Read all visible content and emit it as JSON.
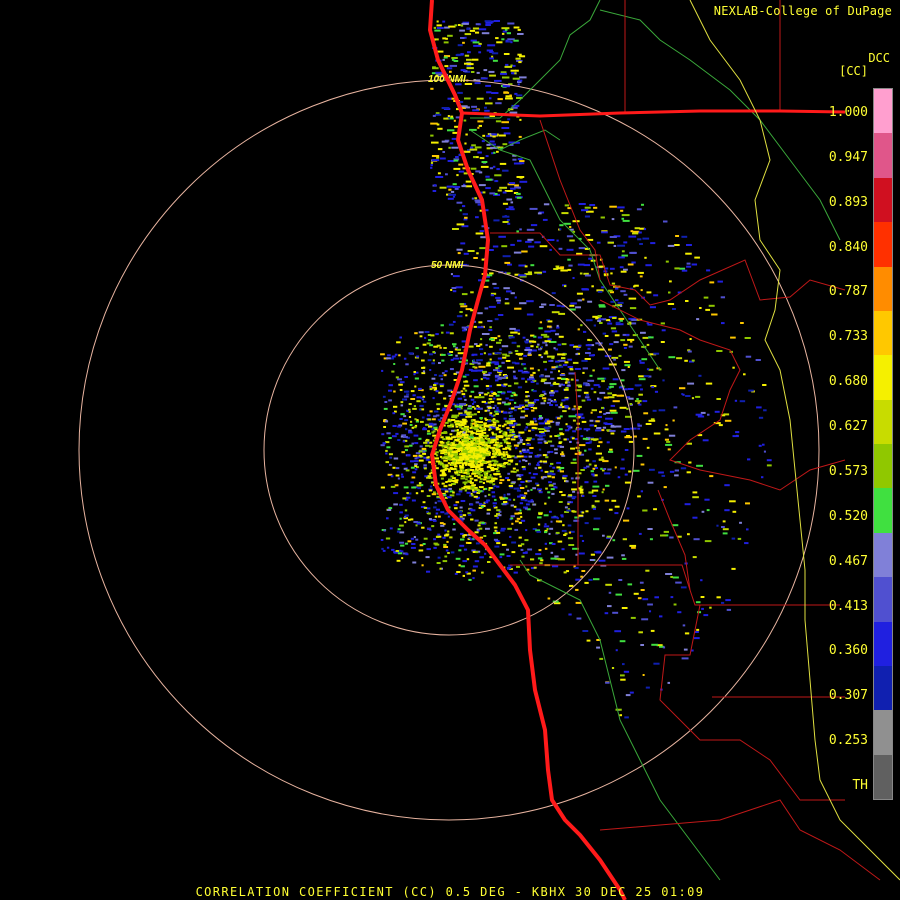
{
  "credit": "NEXLAB-College of DuPage",
  "legend": {
    "product": "DCC",
    "units": "[CC]",
    "ticks": [
      "1.000",
      "0.947",
      "0.893",
      "0.840",
      "0.787",
      "0.733",
      "0.680",
      "0.627",
      "0.573",
      "0.520",
      "0.467",
      "0.413",
      "0.360",
      "0.307",
      "0.253",
      "TH"
    ],
    "colors": [
      "#ff9fcf",
      "#e0568a",
      "#d01020",
      "#ff3000",
      "#ff8c00",
      "#ffc800",
      "#f5f000",
      "#c8dc00",
      "#90c800",
      "#40e040",
      "#8080d8",
      "#5050d0",
      "#2020e0",
      "#1020b0",
      "#909090",
      "#606060"
    ]
  },
  "range_rings": [
    "50 NMI",
    "100 NMI"
  ],
  "footer": "CORRELATION COEFFICIENT (CC) 0.5 DEG - KBHX 30 DEC 25 01:09",
  "map_colors": {
    "ring": "#e8b4a0",
    "coast": "#ff1a1a",
    "county": "#c01818",
    "state": "#e0e040",
    "terrain": "#3aa83a"
  }
}
